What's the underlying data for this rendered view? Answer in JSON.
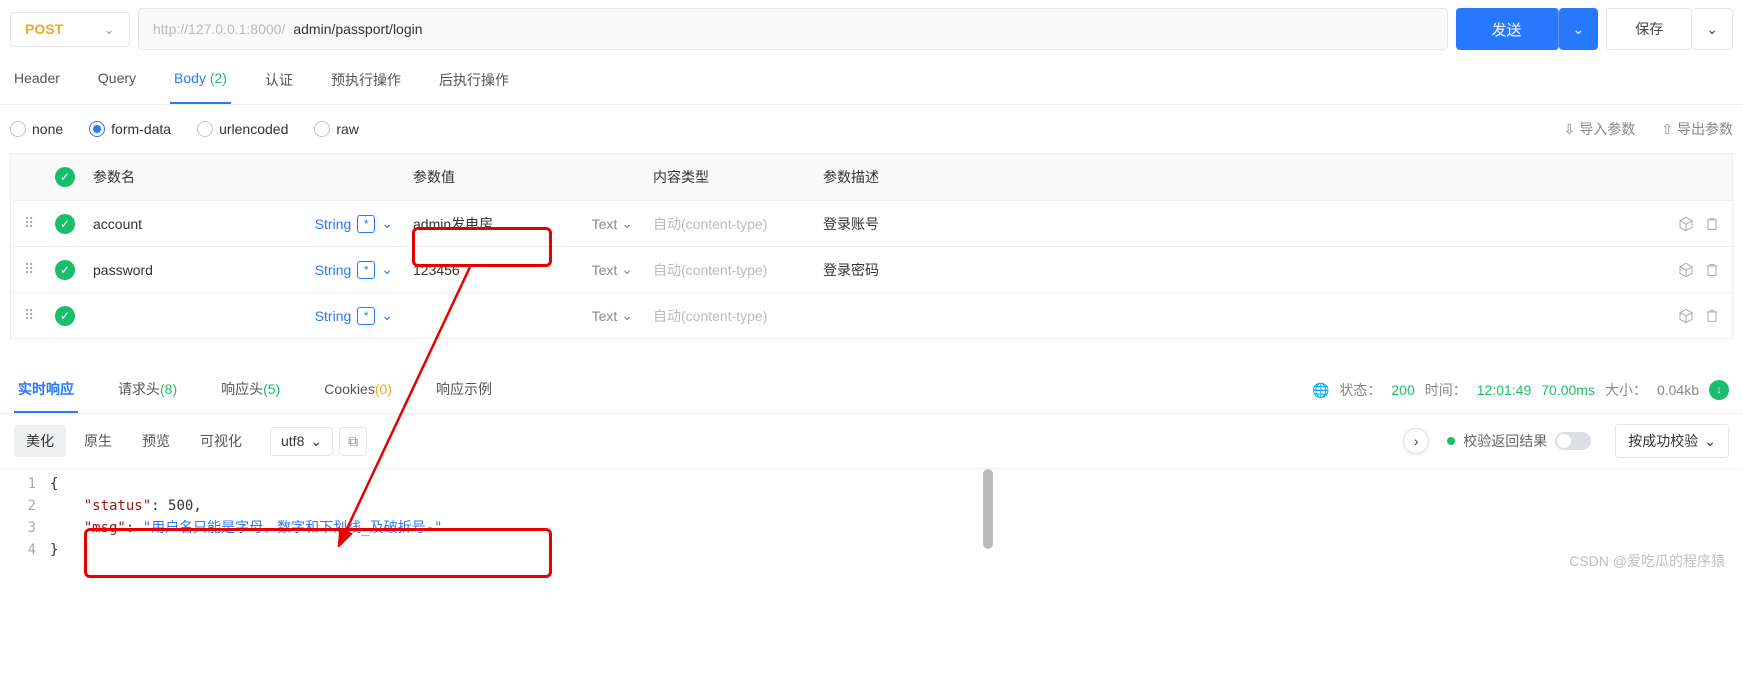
{
  "request": {
    "method": "POST",
    "host": "http://127.0.0.1:8000/",
    "path": "admin/passport/login",
    "send_label": "发送",
    "save_label": "保存"
  },
  "req_tabs": {
    "header": "Header",
    "query": "Query",
    "body": "Body",
    "body_count": "(2)",
    "auth": "认证",
    "pre": "预执行操作",
    "post": "后执行操作"
  },
  "body_types": {
    "none": "none",
    "form": "form-data",
    "urlenc": "urlencoded",
    "raw": "raw"
  },
  "io": {
    "import": "导入参数",
    "export": "导出参数"
  },
  "params": {
    "headers": {
      "name": "参数名",
      "value": "参数值",
      "ctype": "内容类型",
      "desc": "参数描述"
    },
    "type_label": "String",
    "value_type": "Text",
    "content_placeholder": "自动(content-type)",
    "rows": [
      {
        "name": "account",
        "value": "admin发电房",
        "desc": "登录账号"
      },
      {
        "name": "password",
        "value": "123456",
        "desc": "登录密码"
      },
      {
        "name": "",
        "value": "",
        "desc": ""
      }
    ]
  },
  "resp_tabs": {
    "realtime": "实时响应",
    "req_headers": {
      "label": "请求头",
      "count": "(8)"
    },
    "resp_headers": {
      "label": "响应头",
      "count": "(5)"
    },
    "cookies": {
      "label": "Cookies",
      "count": "(0)"
    },
    "example": "响应示例"
  },
  "status": {
    "state_label": "状态：",
    "code": "200",
    "time_label": "时间：",
    "time": "12:01:49",
    "duration": "70.00ms",
    "size_label": "大小：",
    "size": "0.04kb"
  },
  "toolbar": {
    "beautify": "美化",
    "raw": "原生",
    "preview": "预览",
    "visual": "可视化",
    "encoding": "utf8"
  },
  "verify": {
    "label": "校验返回结果",
    "success_btn": "按成功校验"
  },
  "response_json": {
    "l1": "{",
    "l2_key": "\"status\"",
    "l2_val": "500",
    "l3_key": "\"msg\"",
    "l3_val": "\"用户名只能是字母、数字和下划线_及破折号-\"",
    "l4": "}"
  },
  "watermark": "CSDN @爱吃瓜的程序猿"
}
